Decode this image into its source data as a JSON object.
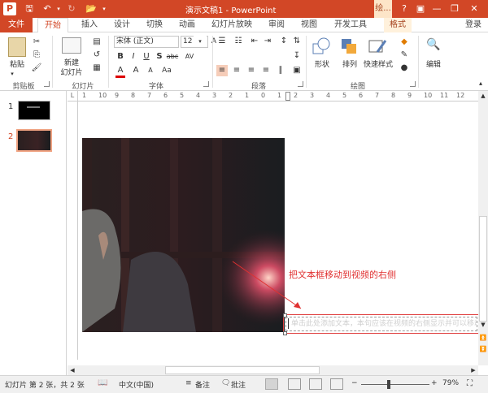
{
  "window": {
    "title": "演示文稿1 - PowerPoint",
    "context_tab_top": "绘...",
    "accent": "#d24726"
  },
  "tabs": [
    "文件",
    "开始",
    "插入",
    "设计",
    "切换",
    "动画",
    "幻灯片放映",
    "审阅",
    "视图",
    "开发工具",
    "格式"
  ],
  "account": "登录",
  "ribbon": {
    "clipboard": {
      "paste": "粘贴",
      "group": "剪贴板"
    },
    "slides": {
      "new_slide_line1": "新建",
      "new_slide_line2": "幻灯片",
      "group": "幻灯片"
    },
    "font": {
      "name": "宋体 (正文)",
      "size": "12",
      "group": "字体",
      "bold": "B",
      "italic": "I",
      "underline": "U",
      "shadow": "S",
      "strike": "abc",
      "spacing": "AV",
      "case": "Aa",
      "color": "A",
      "grow": "A",
      "shrink": "A",
      "clear": "A"
    },
    "paragraph": {
      "group": "段落"
    },
    "drawing": {
      "shape": "形状",
      "arrange": "排列",
      "quick_styles": "快速样式",
      "group": "绘图"
    },
    "editing": {
      "label": "编辑"
    }
  },
  "slides_pane": {
    "slide1_num": "1",
    "slide2_num": "2"
  },
  "ruler": {
    "h_labels": [
      "1",
      "10",
      "9",
      "8",
      "7",
      "6",
      "5",
      "4",
      "3",
      "2",
      "1",
      "0",
      "1",
      "2",
      "3",
      "4",
      "5",
      "6",
      "7",
      "8",
      "9",
      "10",
      "11",
      "12"
    ]
  },
  "annotation": {
    "text": "把文本框移动到视频的右侧"
  },
  "textbox": {
    "text": "单击此处添加文本，本句应该在视频的右侧显示并可以移动"
  },
  "status": {
    "slide_info": "幻灯片 第 2 张，共 2 张",
    "language": "中文(中国)",
    "notes": "备注",
    "comments": "批注",
    "zoom": "79%"
  }
}
